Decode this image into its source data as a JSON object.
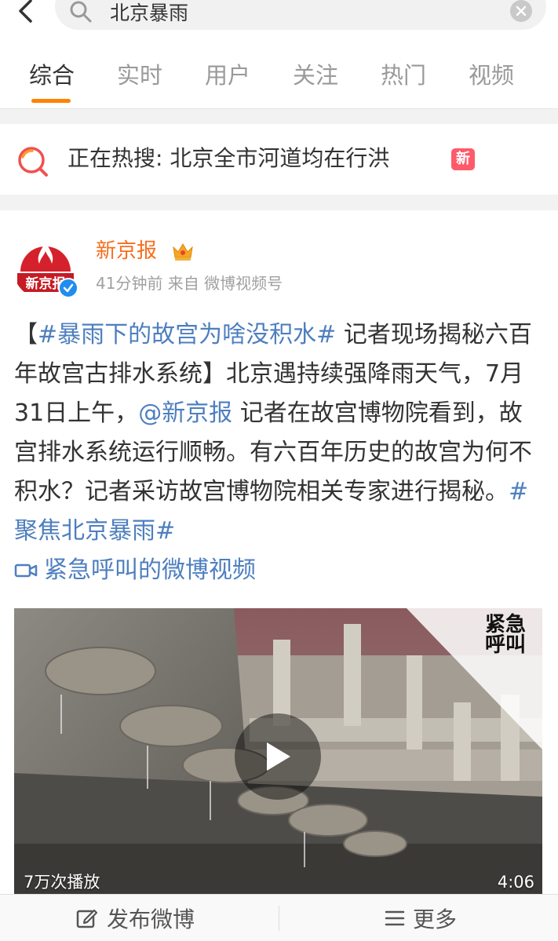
{
  "search": {
    "query": "北京暴雨"
  },
  "tabs": [
    {
      "label": "综合",
      "active": true
    },
    {
      "label": "实时",
      "active": false
    },
    {
      "label": "用户",
      "active": false
    },
    {
      "label": "关注",
      "active": false
    },
    {
      "label": "热门",
      "active": false
    },
    {
      "label": "视频",
      "active": false
    }
  ],
  "hot_search": {
    "text": "正在热搜: 北京全市河道均在行洪",
    "badge": "新"
  },
  "post": {
    "author": "新京报",
    "avatar_text": "新京报",
    "meta": "41分钟前 来自 微博视频号",
    "content": {
      "p1": "【",
      "tag1": "#暴雨下的故宫为啥没积水#",
      "p2": " 记者现场揭秘六百年故宫古排水系统】北京遇持续强降雨天气，7月31日上午，",
      "mention": "@新京报",
      "p3": " 记者在故宫博物院看到，故宫排水系统运行顺畅。有六百年历史的故宫为何不积水？记者采访故宫博物院相关专家进行揭秘。",
      "tag2": "#聚焦北京暴雨#"
    },
    "video_link": "紧急呼叫的微博视频",
    "video": {
      "plays": "7万次播放",
      "duration": "4:06",
      "stamp": "紧急呼叫"
    }
  },
  "bottom_bar": {
    "compose": "发布微博",
    "more": "更多"
  },
  "colors": {
    "accent": "#ff8200",
    "link": "#4e7fbf",
    "author": "#f56e1c",
    "badge": "#ff5a6a"
  }
}
